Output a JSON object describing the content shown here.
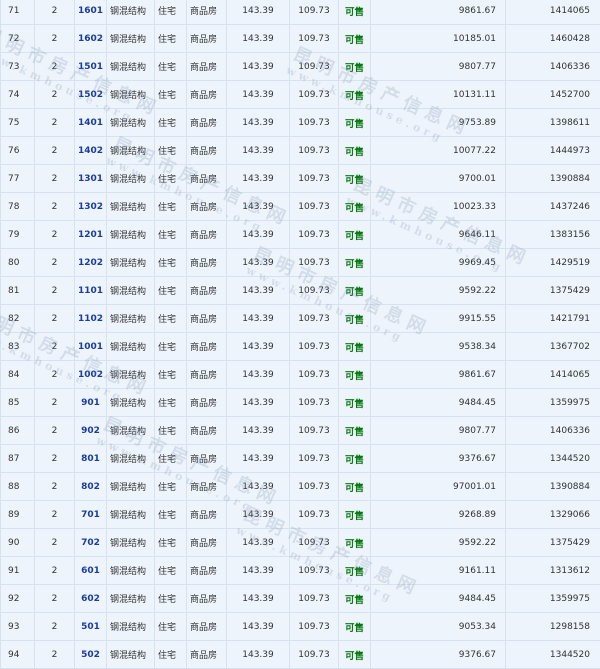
{
  "rows": [
    {
      "seq": "71",
      "building": "2",
      "room": "1601",
      "structure": "钢混结构",
      "use": "住宅",
      "type": "商品房",
      "area_built": "143.39",
      "area_inner": "109.73",
      "status": "可售",
      "price": "9861.67",
      "total": "1414065"
    },
    {
      "seq": "72",
      "building": "2",
      "room": "1602",
      "structure": "钢混结构",
      "use": "住宅",
      "type": "商品房",
      "area_built": "143.39",
      "area_inner": "109.73",
      "status": "可售",
      "price": "10185.01",
      "total": "1460428"
    },
    {
      "seq": "73",
      "building": "2",
      "room": "1501",
      "structure": "钢混结构",
      "use": "住宅",
      "type": "商品房",
      "area_built": "143.39",
      "area_inner": "109.73",
      "status": "可售",
      "price": "9807.77",
      "total": "1406336"
    },
    {
      "seq": "74",
      "building": "2",
      "room": "1502",
      "structure": "钢混结构",
      "use": "住宅",
      "type": "商品房",
      "area_built": "143.39",
      "area_inner": "109.73",
      "status": "可售",
      "price": "10131.11",
      "total": "1452700"
    },
    {
      "seq": "75",
      "building": "2",
      "room": "1401",
      "structure": "钢混结构",
      "use": "住宅",
      "type": "商品房",
      "area_built": "143.39",
      "area_inner": "109.73",
      "status": "可售",
      "price": "9753.89",
      "total": "1398611"
    },
    {
      "seq": "76",
      "building": "2",
      "room": "1402",
      "structure": "钢混结构",
      "use": "住宅",
      "type": "商品房",
      "area_built": "143.39",
      "area_inner": "109.73",
      "status": "可售",
      "price": "10077.22",
      "total": "1444973"
    },
    {
      "seq": "77",
      "building": "2",
      "room": "1301",
      "structure": "钢混结构",
      "use": "住宅",
      "type": "商品房",
      "area_built": "143.39",
      "area_inner": "109.73",
      "status": "可售",
      "price": "9700.01",
      "total": "1390884"
    },
    {
      "seq": "78",
      "building": "2",
      "room": "1302",
      "structure": "钢混结构",
      "use": "住宅",
      "type": "商品房",
      "area_built": "143.39",
      "area_inner": "109.73",
      "status": "可售",
      "price": "10023.33",
      "total": "1437246"
    },
    {
      "seq": "79",
      "building": "2",
      "room": "1201",
      "structure": "钢混结构",
      "use": "住宅",
      "type": "商品房",
      "area_built": "143.39",
      "area_inner": "109.73",
      "status": "可售",
      "price": "9646.11",
      "total": "1383156"
    },
    {
      "seq": "80",
      "building": "2",
      "room": "1202",
      "structure": "钢混结构",
      "use": "住宅",
      "type": "商品房",
      "area_built": "143.39",
      "area_inner": "109.73",
      "status": "可售",
      "price": "9969.45",
      "total": "1429519"
    },
    {
      "seq": "81",
      "building": "2",
      "room": "1101",
      "structure": "钢混结构",
      "use": "住宅",
      "type": "商品房",
      "area_built": "143.39",
      "area_inner": "109.73",
      "status": "可售",
      "price": "9592.22",
      "total": "1375429"
    },
    {
      "seq": "82",
      "building": "2",
      "room": "1102",
      "structure": "钢混结构",
      "use": "住宅",
      "type": "商品房",
      "area_built": "143.39",
      "area_inner": "109.73",
      "status": "可售",
      "price": "9915.55",
      "total": "1421791"
    },
    {
      "seq": "83",
      "building": "2",
      "room": "1001",
      "structure": "钢混结构",
      "use": "住宅",
      "type": "商品房",
      "area_built": "143.39",
      "area_inner": "109.73",
      "status": "可售",
      "price": "9538.34",
      "total": "1367702"
    },
    {
      "seq": "84",
      "building": "2",
      "room": "1002",
      "structure": "钢混结构",
      "use": "住宅",
      "type": "商品房",
      "area_built": "143.39",
      "area_inner": "109.73",
      "status": "可售",
      "price": "9861.67",
      "total": "1414065"
    },
    {
      "seq": "85",
      "building": "2",
      "room": "901",
      "structure": "钢混结构",
      "use": "住宅",
      "type": "商品房",
      "area_built": "143.39",
      "area_inner": "109.73",
      "status": "可售",
      "price": "9484.45",
      "total": "1359975"
    },
    {
      "seq": "86",
      "building": "2",
      "room": "902",
      "structure": "钢混结构",
      "use": "住宅",
      "type": "商品房",
      "area_built": "143.39",
      "area_inner": "109.73",
      "status": "可售",
      "price": "9807.77",
      "total": "1406336"
    },
    {
      "seq": "87",
      "building": "2",
      "room": "801",
      "structure": "钢混结构",
      "use": "住宅",
      "type": "商品房",
      "area_built": "143.39",
      "area_inner": "109.73",
      "status": "可售",
      "price": "9376.67",
      "total": "1344520"
    },
    {
      "seq": "88",
      "building": "2",
      "room": "802",
      "structure": "钢混结构",
      "use": "住宅",
      "type": "商品房",
      "area_built": "143.39",
      "area_inner": "109.73",
      "status": "可售",
      "price": "97001.01",
      "total": "1390884"
    },
    {
      "seq": "89",
      "building": "2",
      "room": "701",
      "structure": "钢混结构",
      "use": "住宅",
      "type": "商品房",
      "area_built": "143.39",
      "area_inner": "109.73",
      "status": "可售",
      "price": "9268.89",
      "total": "1329066"
    },
    {
      "seq": "90",
      "building": "2",
      "room": "702",
      "structure": "钢混结构",
      "use": "住宅",
      "type": "商品房",
      "area_built": "143.39",
      "area_inner": "109.73",
      "status": "可售",
      "price": "9592.22",
      "total": "1375429"
    },
    {
      "seq": "91",
      "building": "2",
      "room": "601",
      "structure": "钢混结构",
      "use": "住宅",
      "type": "商品房",
      "area_built": "143.39",
      "area_inner": "109.73",
      "status": "可售",
      "price": "9161.11",
      "total": "1313612"
    },
    {
      "seq": "92",
      "building": "2",
      "room": "602",
      "structure": "钢混结构",
      "use": "住宅",
      "type": "商品房",
      "area_built": "143.39",
      "area_inner": "109.73",
      "status": "可售",
      "price": "9484.45",
      "total": "1359975"
    },
    {
      "seq": "93",
      "building": "2",
      "room": "501",
      "structure": "钢混结构",
      "use": "住宅",
      "type": "商品房",
      "area_built": "143.39",
      "area_inner": "109.73",
      "status": "可售",
      "price": "9053.34",
      "total": "1298158"
    },
    {
      "seq": "94",
      "building": "2",
      "room": "502",
      "structure": "钢混结构",
      "use": "住宅",
      "type": "商品房",
      "area_built": "143.39",
      "area_inner": "109.73",
      "status": "可售",
      "price": "9376.67",
      "total": "1344520"
    }
  ],
  "watermark": {
    "cn": "昆明市房产信息网",
    "url": "www.kmhouse.org"
  },
  "colors": {
    "cell_bg": "#eef4fb",
    "border": "#d6e3ef",
    "room_blue": "#1b3c9c",
    "status_green": "#0a7a12"
  }
}
